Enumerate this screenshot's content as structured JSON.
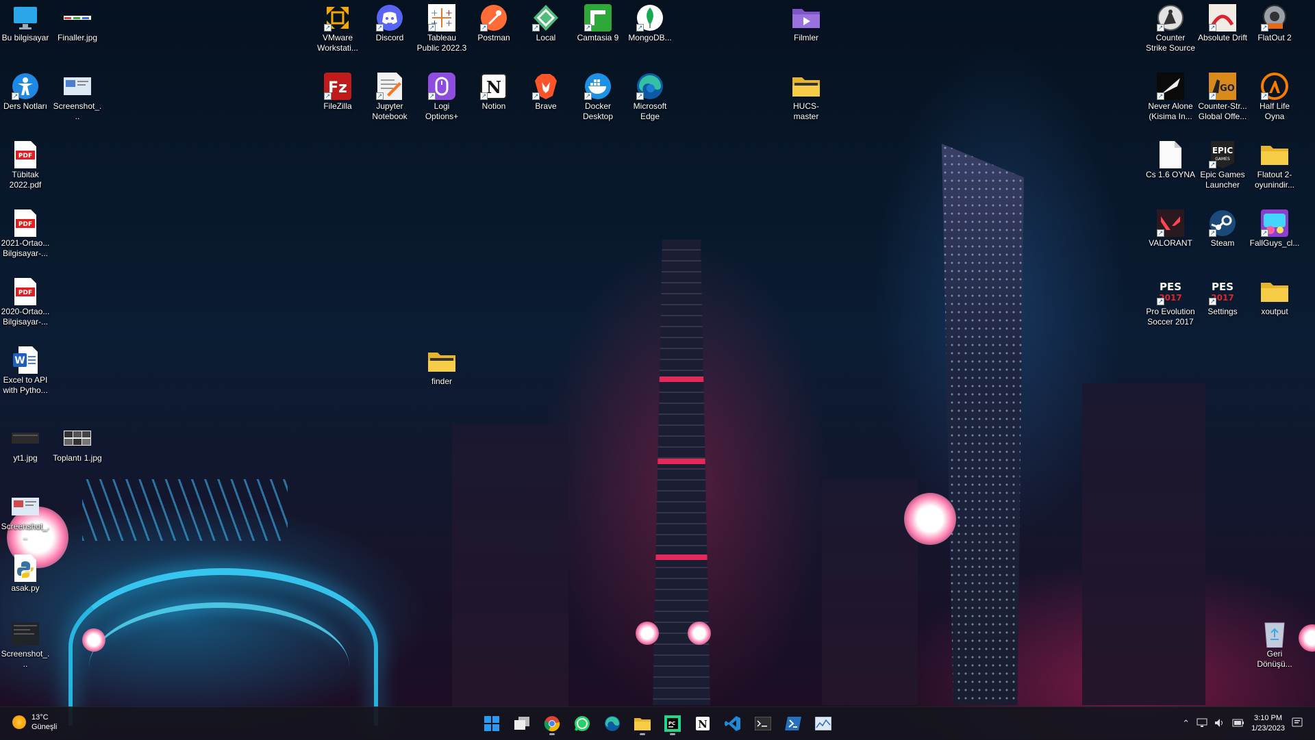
{
  "desktop": {
    "icons": [
      {
        "label": "Bu bilgisayar",
        "icon": "monitor-icon"
      },
      {
        "label": "Finaller.jpg",
        "icon": "image-file-icon"
      },
      {
        "label": "Ders Notları",
        "icon": "accessibility-icon"
      },
      {
        "label": "Screenshot_...",
        "icon": "image-file-icon"
      },
      {
        "label": "Tübitak 2022.pdf",
        "icon": "pdf-icon"
      },
      {
        "label": "2021-Ortao... Bilgisayar-...",
        "icon": "pdf-icon"
      },
      {
        "label": "2020-Ortao... Bilgisayar-...",
        "icon": "pdf-icon"
      },
      {
        "label": "Excel to API with Pytho...",
        "icon": "word-icon"
      },
      {
        "label": "yt1.jpg",
        "icon": "image-file-icon"
      },
      {
        "label": "Toplantı 1.jpg",
        "icon": "image-file-icon"
      },
      {
        "label": "Screenshot_...",
        "icon": "image-file-icon"
      },
      {
        "label": "asak.py",
        "icon": "python-icon"
      },
      {
        "label": "Screenshot_...",
        "icon": "image-file-icon"
      },
      {
        "label": "VMware Workstati...",
        "icon": "vmware-icon"
      },
      {
        "label": "Discord",
        "icon": "discord-icon"
      },
      {
        "label": "Tableau Public 2022.3",
        "icon": "tableau-icon"
      },
      {
        "label": "Postman",
        "icon": "postman-icon"
      },
      {
        "label": "Local",
        "icon": "local-icon"
      },
      {
        "label": "Camtasia 9",
        "icon": "camtasia-icon"
      },
      {
        "label": "MongoDB...",
        "icon": "mongodb-icon"
      },
      {
        "label": "FileZilla",
        "icon": "filezilla-icon"
      },
      {
        "label": "Jupyter Notebook",
        "icon": "jupyter-icon"
      },
      {
        "label": "Logi Options+",
        "icon": "logi-icon"
      },
      {
        "label": "Notion",
        "icon": "notion-icon"
      },
      {
        "label": "Brave",
        "icon": "brave-icon"
      },
      {
        "label": "Docker Desktop",
        "icon": "docker-icon"
      },
      {
        "label": "Microsoft Edge",
        "icon": "edge-icon"
      },
      {
        "label": "finder",
        "icon": "folder-icon"
      },
      {
        "label": "Filmler",
        "icon": "video-folder-icon"
      },
      {
        "label": "HUCS-master",
        "icon": "folder-icon"
      },
      {
        "label": "Counter Strike Source",
        "icon": "css-game-icon"
      },
      {
        "label": "Absolute Drift",
        "icon": "drift-game-icon"
      },
      {
        "label": "FlatOut 2",
        "icon": "flatout-game-icon"
      },
      {
        "label": "Never Alone (Kisima In...",
        "icon": "never-alone-icon"
      },
      {
        "label": "Counter-Str... Global Offe...",
        "icon": "csgo-icon"
      },
      {
        "label": "Half Life Oyna",
        "icon": "half-life-icon"
      },
      {
        "label": "Cs 1.6 OYNA",
        "icon": "blank-file-icon"
      },
      {
        "label": "Epic Games Launcher",
        "icon": "epic-games-icon"
      },
      {
        "label": "Flatout 2-oyunindir...",
        "icon": "folder-icon"
      },
      {
        "label": "VALORANT",
        "icon": "valorant-icon"
      },
      {
        "label": "Steam",
        "icon": "steam-icon"
      },
      {
        "label": "FallGuys_cl...",
        "icon": "fallguys-icon"
      },
      {
        "label": "Pro Evolution Soccer 2017",
        "icon": "pes-icon"
      },
      {
        "label": "Settings",
        "icon": "pes-icon"
      },
      {
        "label": "xoutput",
        "icon": "folder-icon"
      },
      {
        "label": "Geri Dönüşü...",
        "icon": "recycle-bin-icon"
      }
    ]
  },
  "taskbar": {
    "weather": {
      "temp": "13°C",
      "condition": "Güneşli"
    },
    "apps": [
      "windows-start-icon",
      "task-view-icon",
      "chrome-icon",
      "whatsapp-icon",
      "edge-icon",
      "file-explorer-icon",
      "pycharm-icon",
      "notion-icon",
      "vscode-icon",
      "terminal-icon",
      "powershell-icon",
      "resource-monitor-icon"
    ],
    "time": "3:10 PM",
    "date": "1/23/2023"
  },
  "colors": {
    "taskbar_bg": "#14161e",
    "accent": "#0078d4"
  }
}
